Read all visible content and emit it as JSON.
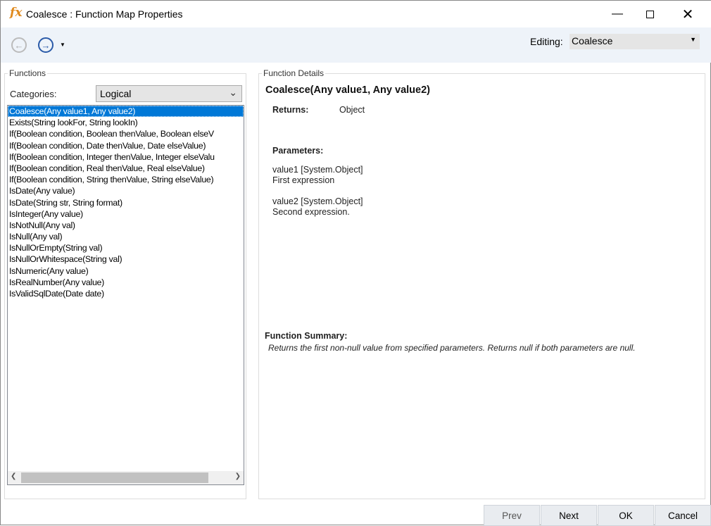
{
  "window": {
    "title": "Coalesce : Function Map Properties",
    "icon": "fx-icon"
  },
  "toolbar": {
    "editing_label": "Editing:",
    "editing_value": "Coalesce"
  },
  "functions": {
    "legend": "Functions",
    "categories_label": "Categories:",
    "category": "Logical",
    "items": [
      "Coalesce(Any value1, Any value2)",
      "Exists(String lookFor, String lookIn)",
      "If(Boolean condition, Boolean thenValue, Boolean elseV",
      "If(Boolean condition, Date thenValue, Date elseValue)",
      "If(Boolean condition, Integer thenValue, Integer elseValu",
      "If(Boolean condition, Real thenValue, Real elseValue)",
      "If(Boolean condition, String thenValue, String elseValue)",
      "IsDate(Any value)",
      "IsDate(String str, String format)",
      "IsInteger(Any value)",
      "IsNotNull(Any val)",
      "IsNull(Any val)",
      "IsNullOrEmpty(String val)",
      "IsNullOrWhitespace(String val)",
      "IsNumeric(Any value)",
      "IsRealNumber(Any value)",
      "IsValidSqlDate(Date date)"
    ]
  },
  "details": {
    "legend": "Function Details",
    "signature": "Coalesce(Any value1, Any value2)",
    "returns_label": "Returns:",
    "returns_value": "Object",
    "parameters_label": "Parameters:",
    "params": [
      {
        "name": "value1 [System.Object]",
        "desc": "First expression"
      },
      {
        "name": "value2 [System.Object]",
        "desc": "Second expression."
      }
    ],
    "summary_label": "Function Summary:",
    "summary": "Returns the first non-null value from specified parameters. Returns null if both parameters are null."
  },
  "buttons": {
    "prev": "Prev",
    "next": "Next",
    "ok": "OK",
    "cancel": "Cancel"
  }
}
